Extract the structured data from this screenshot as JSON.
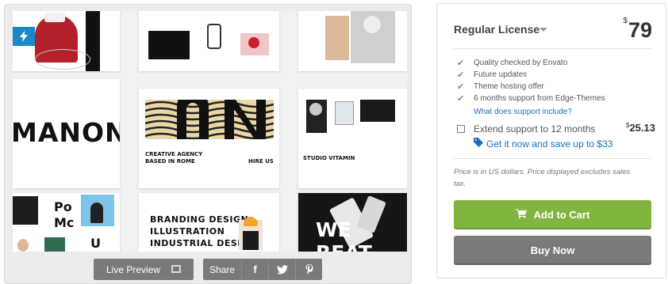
{
  "preview": {
    "badge_icon": "lightning-icon",
    "tiles": {
      "manon_word": "MANON",
      "agency_title_1": "CREATIVE AGENCY",
      "agency_title_2": "BASED IN ROME",
      "hire_us": "HIRE US",
      "studio": "STUDIO VITAMIN",
      "branding_1": "BRANDING DESIGN",
      "branding_2": "ILLUSTRATION",
      "branding_3": "INDUSTRIAL DESIGN",
      "pomo_1": "Po",
      "pomo_2": "Mc",
      "pomo_3": "U",
      "weareat": "WE REAT"
    },
    "live_preview_label": "Live Preview",
    "share_label": "Share",
    "share_icons": [
      "facebook-icon",
      "twitter-icon",
      "pinterest-icon"
    ]
  },
  "purchase": {
    "license_name": "Regular License",
    "price_currency": "$",
    "price": "79",
    "features": [
      "Quality checked by Envato",
      "Future updates",
      "Theme hosting offer",
      "6 months support from Edge-Themes"
    ],
    "support_link": "What does support include?",
    "extend_label": "Extend support to 12 months",
    "extend_currency": "$",
    "extend_price": "25.13",
    "extend_save": "Get it now and save up to $33",
    "note": "Price is in US dollars. Price displayed excludes sales tax.",
    "add_to_cart": "Add to Cart",
    "buy_now": "Buy Now"
  },
  "colors": {
    "cart_green": "#82b440",
    "buy_gray": "#7a7a7a",
    "link_blue": "#1a6fba",
    "badge_blue": "#1b87c9"
  }
}
